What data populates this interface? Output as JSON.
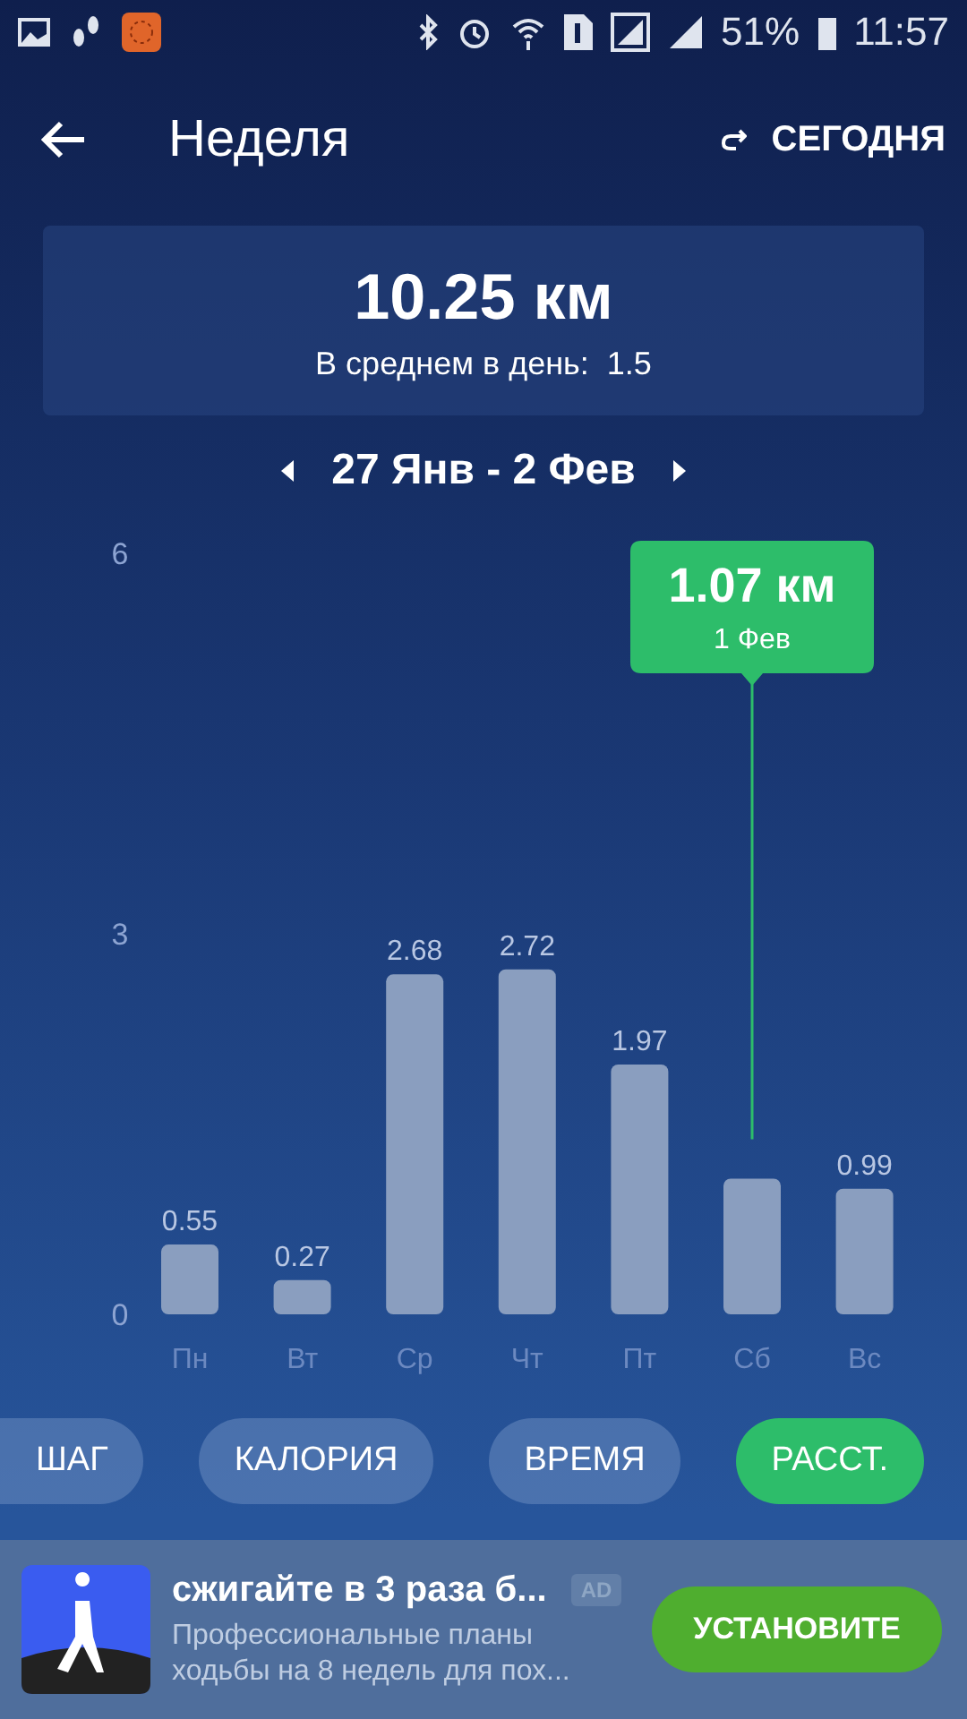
{
  "status_bar": {
    "battery": "51%",
    "time": "11:57"
  },
  "toolbar": {
    "title": "Неделя",
    "action": "СЕГОДНЯ"
  },
  "summary": {
    "total": "10.25 км",
    "average_label": "В среднем в день:",
    "average_value": "1.5"
  },
  "date_range": {
    "label": "27 Янв - 2 Фев"
  },
  "chart": {
    "chart_data": {
      "type": "bar",
      "categories": [
        "Пн",
        "Вт",
        "Ср",
        "Чт",
        "Пт",
        "Сб",
        "Вс"
      ],
      "values": [
        0.55,
        0.27,
        2.68,
        2.72,
        1.97,
        1.07,
        0.99
      ],
      "ylim": [
        0,
        6
      ],
      "yticks": [
        0,
        3,
        6
      ],
      "value_labels": [
        "0.55",
        "0.27",
        "2.68",
        "2.72",
        "1.97",
        null,
        "0.99"
      ]
    },
    "tooltip": {
      "value": "1.07 км",
      "date": "1 Фев"
    }
  },
  "metric_tabs": [
    {
      "label": "ШАГ",
      "selected": false
    },
    {
      "label": "КАЛОРИЯ",
      "selected": false
    },
    {
      "label": "ВРЕМЯ",
      "selected": false
    },
    {
      "label": "РАССТ.",
      "selected": true
    }
  ],
  "ad": {
    "title": "сжигайте в 3 раза б...",
    "badge": "AD",
    "text": "Профессиональные планы ходьбы на 8 недель для пох...",
    "button": "УСТАНОВИТЕ"
  }
}
